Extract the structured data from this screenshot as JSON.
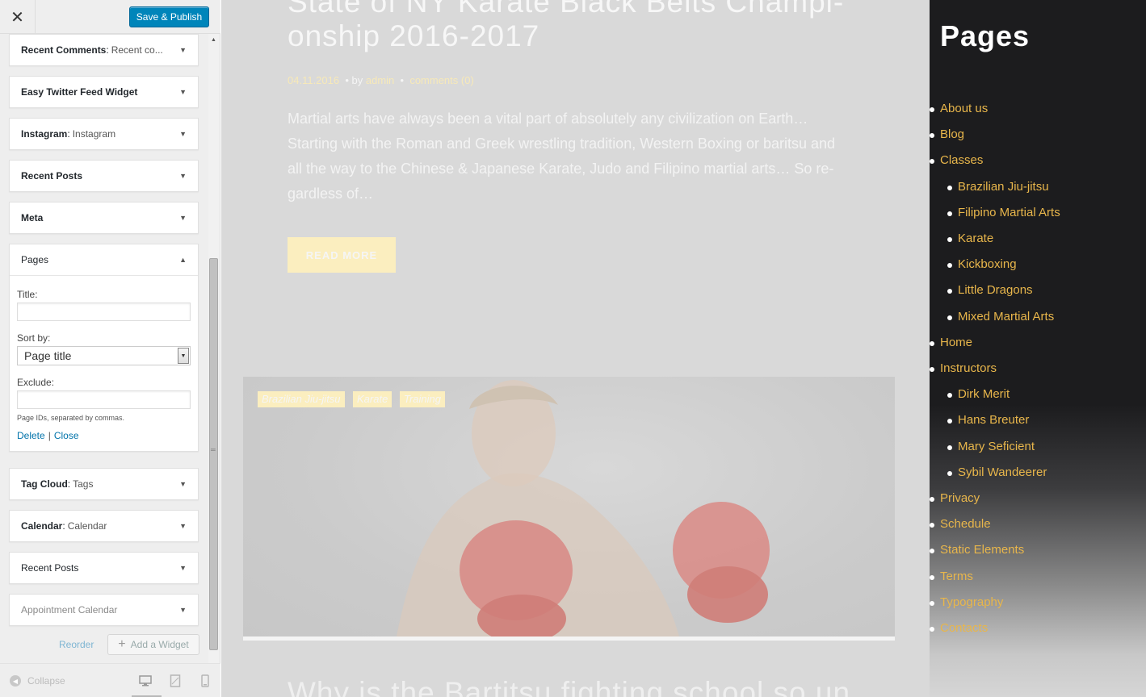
{
  "customizer": {
    "close_icon": "close-icon",
    "publish_label": "Save & Publish",
    "widgets": [
      {
        "name": "Recent Comments",
        "sub": "Recent co..."
      },
      {
        "name": "Easy Twitter Feed Widget",
        "sub": ""
      },
      {
        "name": "Instagram",
        "sub": "Instagram"
      },
      {
        "name": "Recent Posts",
        "sub": ""
      },
      {
        "name": "Meta",
        "sub": ""
      },
      {
        "name": "Pages",
        "sub": ""
      },
      {
        "name": "Tag Cloud",
        "sub": "Tags"
      },
      {
        "name": "Calendar",
        "sub": "Calendar"
      },
      {
        "name": "Recent Posts",
        "sub": ""
      },
      {
        "name": "Appointment Calendar",
        "sub": ""
      }
    ],
    "pages_form": {
      "title_label": "Title:",
      "title_value": "",
      "sortby_label": "Sort by:",
      "sortby_value": "Page title",
      "exclude_label": "Exclude:",
      "exclude_value": "",
      "help": "Page IDs, separated by commas.",
      "delete_label": "Delete",
      "close_label": "Close"
    },
    "reorder_label": "Reorder",
    "add_widget_label": "Add a Widget",
    "collapse_label": "Collapse"
  },
  "preview": {
    "post_title": "State of NY Karate Black Belts Champi- onship 2016-2017",
    "meta": {
      "date": "04.11.2016",
      "by": "by",
      "author": "admin",
      "comments": "comments (0)"
    },
    "excerpt": "Martial arts have always been a vital part of absolutely any civilization on Earth… Starting with the Roman and Greek wrestling tradition, Western Boxing or baritsu and all the way to the Chinese & Japanese Karate, Judo and Filipino martial arts… So re- gardless of…",
    "read_more": "READ MORE",
    "tags": [
      "Brazilian Jiu-jitsu",
      "Karate",
      "Training"
    ],
    "next_post_title": "Why is the Bartitsu fighting school so un"
  },
  "sidebar": {
    "title": "Pages",
    "pages": [
      {
        "label": "About us",
        "level": 0
      },
      {
        "label": "Blog",
        "level": 0
      },
      {
        "label": "Classes",
        "level": 0
      },
      {
        "label": "Brazilian Jiu-jitsu",
        "level": 1
      },
      {
        "label": "Filipino Martial Arts",
        "level": 1
      },
      {
        "label": "Karate",
        "level": 1
      },
      {
        "label": "Kickboxing",
        "level": 1
      },
      {
        "label": "Little Dragons",
        "level": 1
      },
      {
        "label": "Mixed Martial Arts",
        "level": 1
      },
      {
        "label": "Home",
        "level": 0
      },
      {
        "label": "Instructors",
        "level": 0
      },
      {
        "label": "Dirk Merit",
        "level": 1
      },
      {
        "label": "Hans Breuter",
        "level": 1
      },
      {
        "label": "Mary Seficient",
        "level": 1
      },
      {
        "label": "Sybil Wandeerer",
        "level": 1
      },
      {
        "label": "Privacy",
        "level": 0
      },
      {
        "label": "Schedule",
        "level": 0
      },
      {
        "label": "Static Elements",
        "level": 0
      },
      {
        "label": "Terms",
        "level": 0
      },
      {
        "label": "Typography",
        "level": 0
      },
      {
        "label": "Contacts",
        "level": 0
      }
    ]
  },
  "colors": {
    "accent": "#0085ba",
    "link_gold": "#e8b64b",
    "sidebar_dark": "#1c1c1e"
  }
}
